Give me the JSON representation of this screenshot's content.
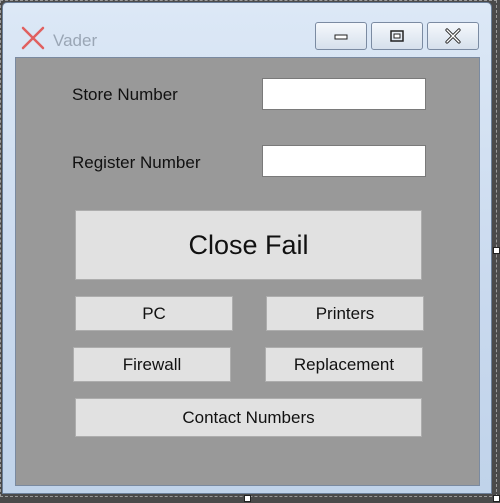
{
  "window": {
    "title": "Vader",
    "controls": {
      "minimize": "minimize-icon",
      "maximize": "maximize-icon",
      "close": "close-icon"
    }
  },
  "form": {
    "store_label": "Store Number",
    "store_value": "",
    "register_label": "Register Number",
    "register_value": ""
  },
  "buttons": {
    "close_fail": "Close Fail",
    "pc": "PC",
    "printers": "Printers",
    "firewall": "Firewall",
    "replacement": "Replacement",
    "contact_numbers": "Contact Numbers"
  },
  "colors": {
    "client_background": "#999999",
    "button_face": "#e1e1e1",
    "app_icon": "#e06060"
  }
}
